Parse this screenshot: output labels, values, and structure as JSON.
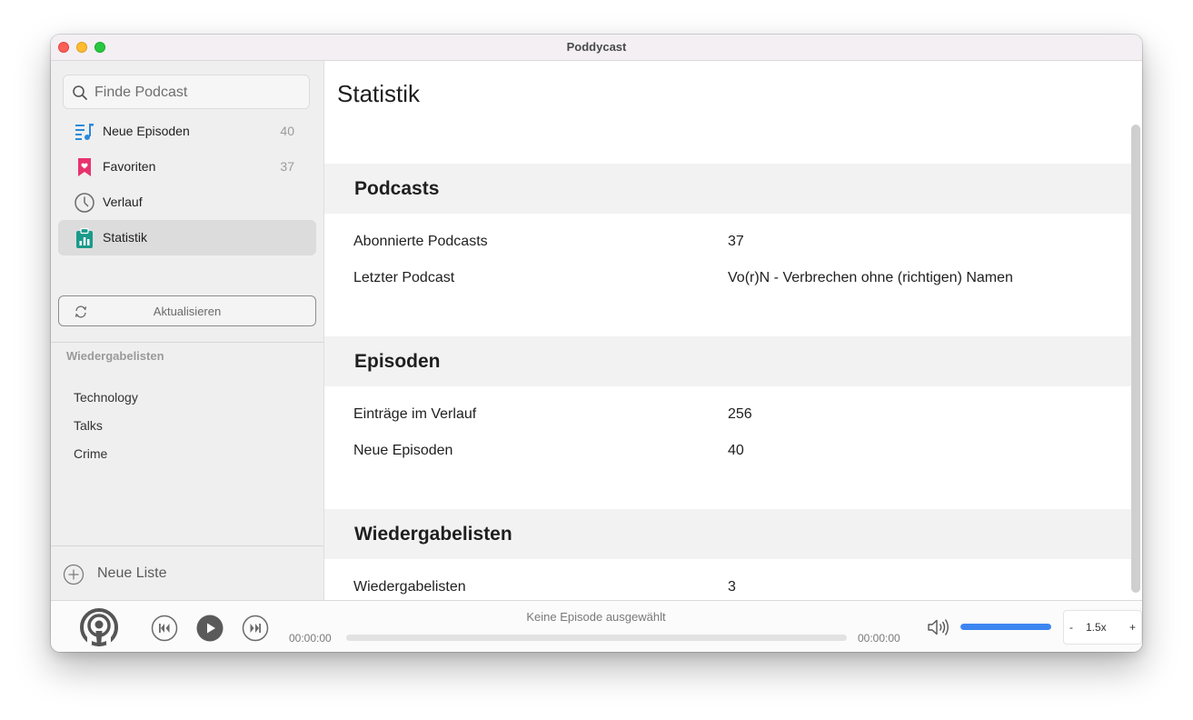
{
  "window": {
    "title": "Poddycast"
  },
  "sidebar": {
    "search": {
      "placeholder": "Finde Podcast",
      "value": ""
    },
    "nav": [
      {
        "label": "Neue Episoden",
        "count": "40",
        "icon": "playlist-music-icon"
      },
      {
        "label": "Favoriten",
        "count": "37",
        "icon": "bookmark-heart-icon"
      },
      {
        "label": "Verlauf",
        "count": "",
        "icon": "clock-icon"
      },
      {
        "label": "Statistik",
        "count": "",
        "icon": "clipboard-chart-icon"
      }
    ],
    "refresh_label": "Aktualisieren",
    "playlists_header": "Wiedergabelisten",
    "playlists": [
      "Technology",
      "Talks",
      "Crime"
    ],
    "new_list_label": "Neue Liste"
  },
  "main": {
    "title": "Statistik",
    "sections": [
      {
        "heading": "Podcasts",
        "rows": [
          {
            "label": "Abonnierte Podcasts",
            "value": "37"
          },
          {
            "label": "Letzter Podcast",
            "value": "Vo(r)N - Verbrechen ohne (richtigen) Namen"
          }
        ]
      },
      {
        "heading": "Episoden",
        "rows": [
          {
            "label": "Einträge im Verlauf",
            "value": "256"
          },
          {
            "label": "Neue Episoden",
            "value": "40"
          }
        ]
      },
      {
        "heading": "Wiedergabelisten",
        "rows": [
          {
            "label": "Wiedergabelisten",
            "value": "3"
          }
        ]
      }
    ]
  },
  "player": {
    "episode_title": "Keine Episode ausgewählt",
    "time_elapsed": "00:00:00",
    "time_remaining": "00:00:00",
    "progress": 0,
    "volume": 1.0,
    "speed": {
      "minus": "-",
      "value": "1.5x",
      "plus": "+"
    }
  },
  "colors": {
    "accent_blue": "#3d86f0",
    "favorite_pink": "#e8336d",
    "stats_teal": "#1a9a8a",
    "nav_blue": "#2a8ad8"
  }
}
